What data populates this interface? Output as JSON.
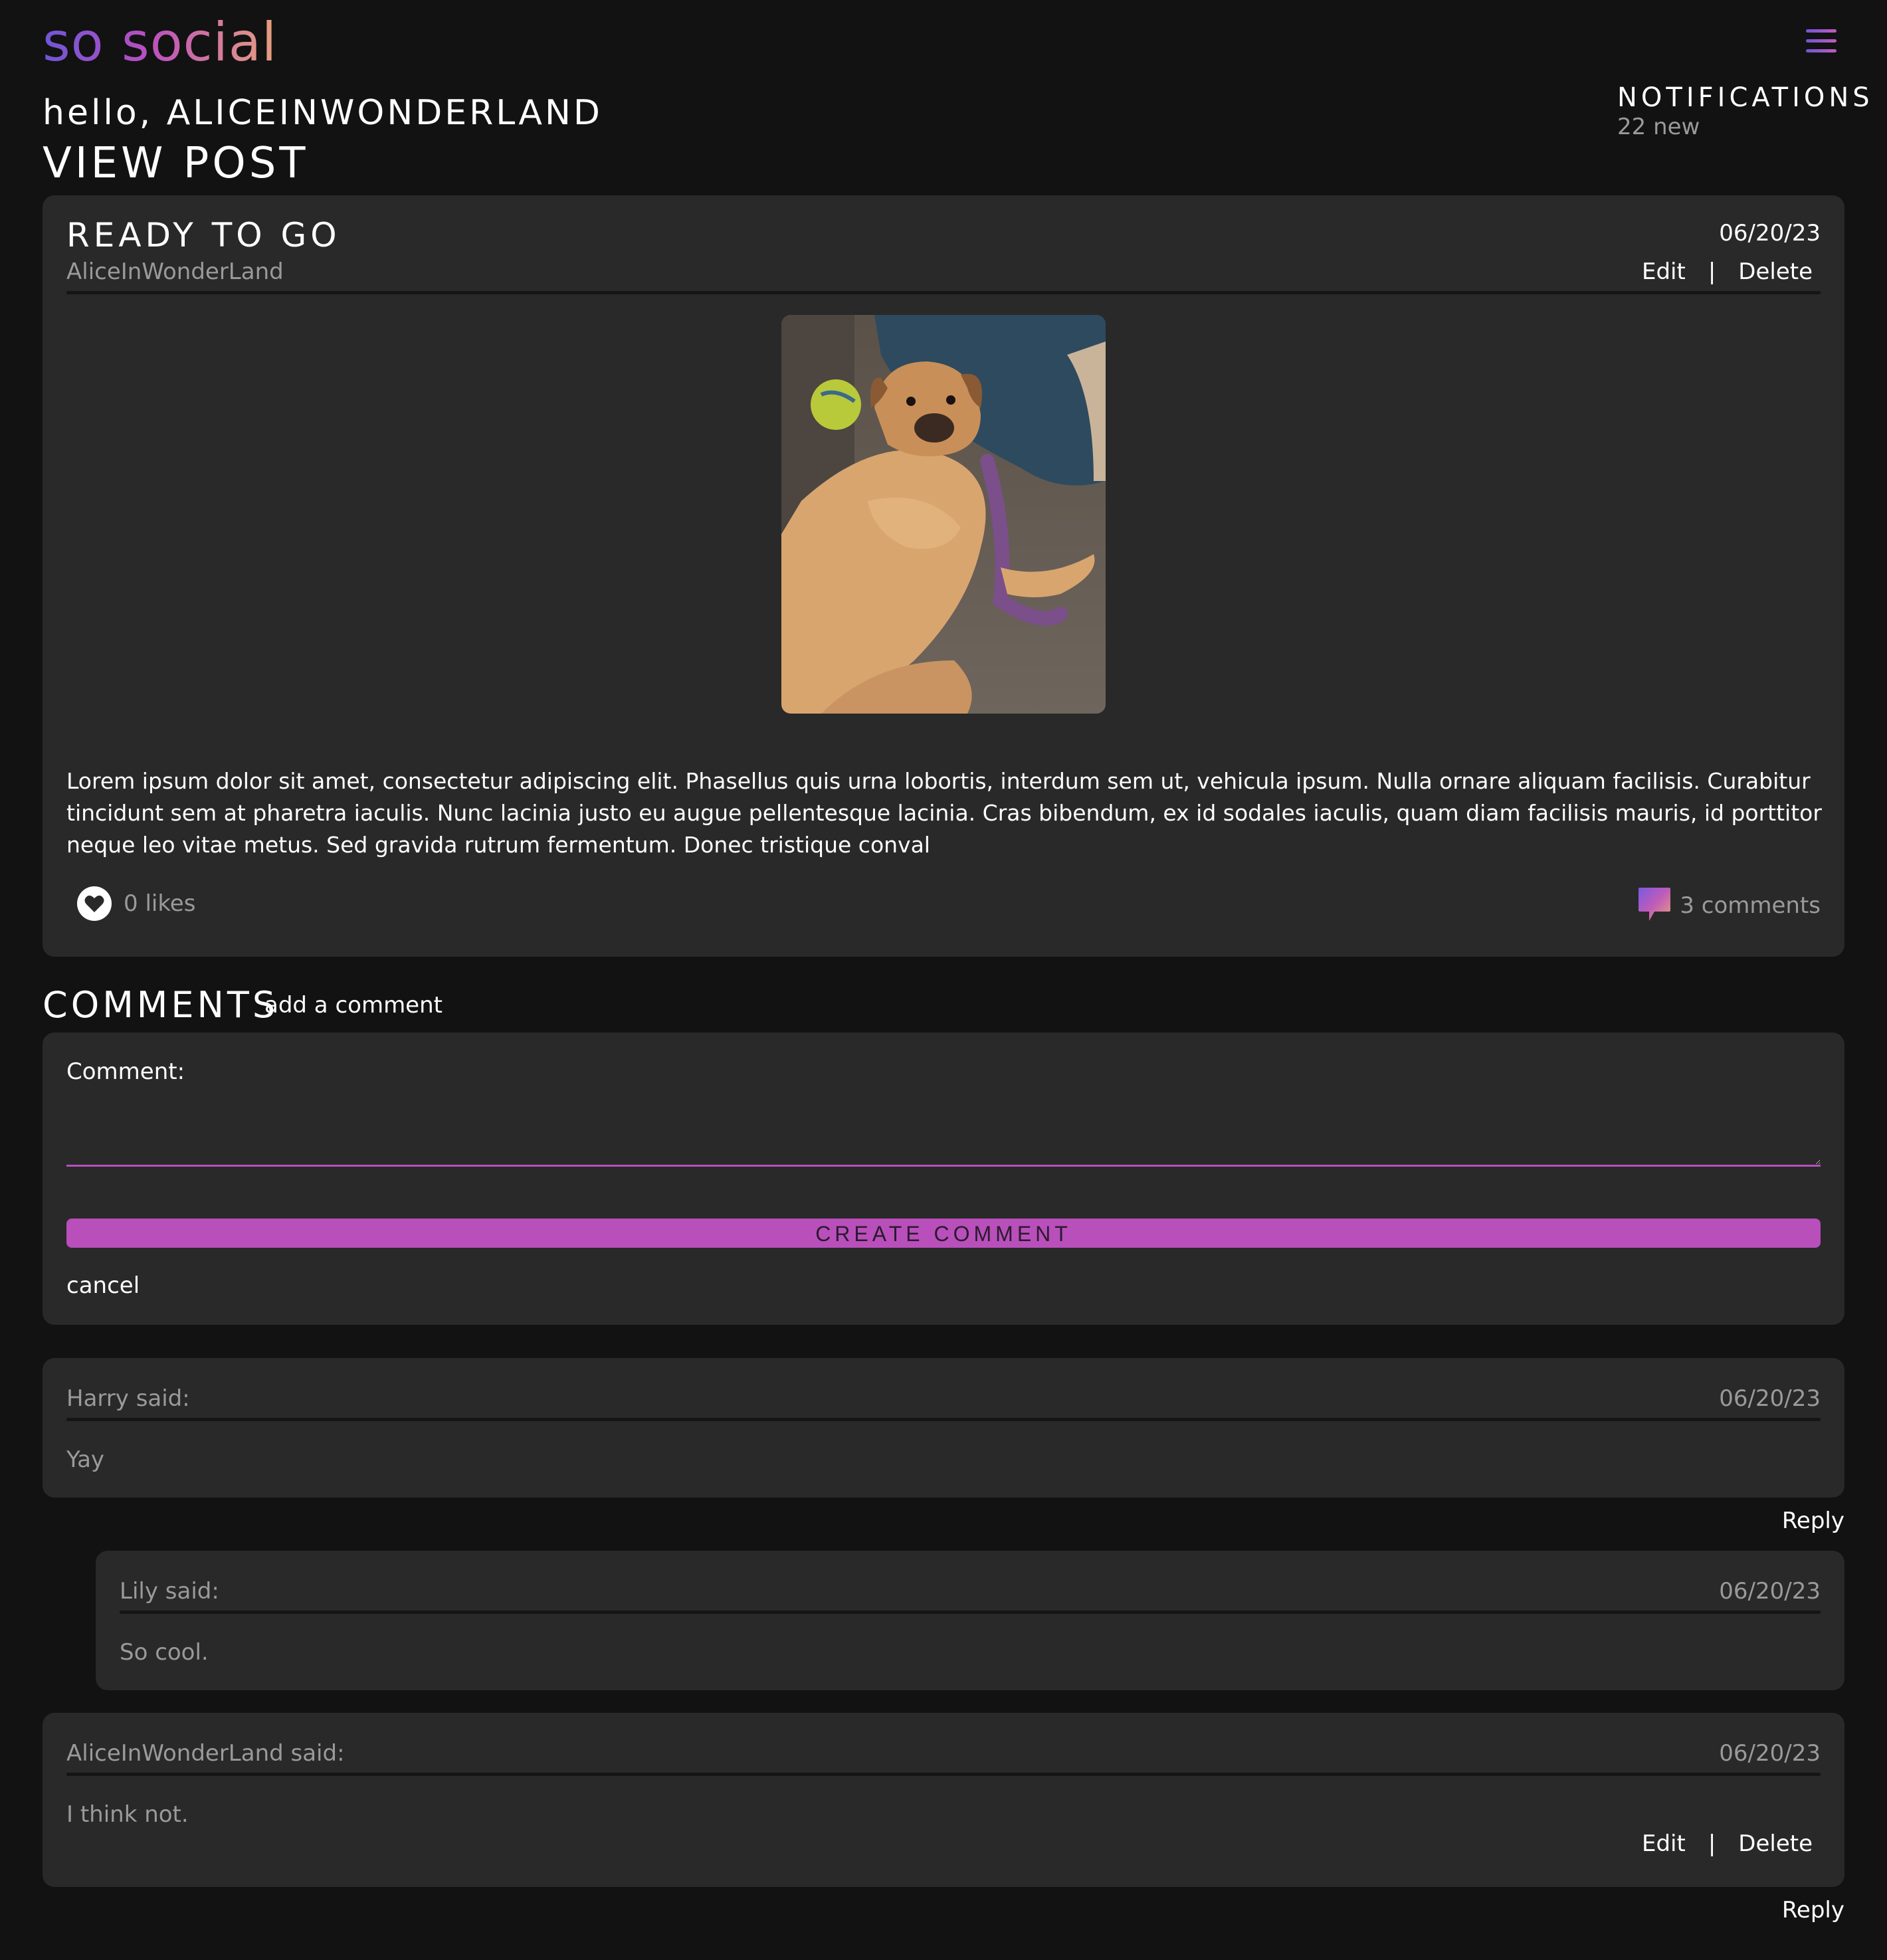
{
  "app": {
    "logo": "so social",
    "greeting": "hello, ALICEINWONDERLAND",
    "page_title": "VIEW POST",
    "notifications": {
      "title": "NOTIFICATIONS",
      "count_label": "22 new"
    },
    "colors": {
      "accent": "#b94fbb",
      "background": "#121212",
      "card": "#292929",
      "muted": "#9a9a9a"
    }
  },
  "post": {
    "title": "READY TO GO",
    "author": "AliceInWonderLand",
    "date": "06/20/23",
    "edit_label": "Edit",
    "separator": "|",
    "delete_label": "Delete",
    "image_alt_icon": "dog-photo",
    "body": "Lorem ipsum dolor sit amet, consectetur adipiscing elit. Phasellus quis urna lobortis, interdum sem ut, vehicula ipsum. Nulla ornare aliquam facilisis. Curabitur tincidunt sem at pharetra iaculis. Nunc lacinia justo eu augue pellentesque lacinia. Cras bibendum, ex id sodales iaculis, quam diam facilisis mauris, id porttitor neque leo vitae metus. Sed gravida rutrum fermentum. Donec tristique conval",
    "likes_label": "0 likes",
    "comments_label": "3 comments"
  },
  "comments_section": {
    "heading": "COMMENTS",
    "add_label": "add a comment",
    "form": {
      "label": "Comment:",
      "value": "",
      "submit_label": "CREATE COMMENT",
      "cancel_label": "cancel"
    }
  },
  "comments": [
    {
      "author": "Harry said:",
      "date": "06/20/23",
      "text": "Yay",
      "reply_label": "Reply"
    },
    {
      "author": "Lily said:",
      "date": "06/20/23",
      "text": "So cool."
    },
    {
      "author": "AliceInWonderLand said:",
      "date": "06/20/23",
      "text": "I think not.",
      "edit_label": "Edit",
      "separator": "|",
      "delete_label": "Delete",
      "reply_label": "Reply"
    }
  ]
}
